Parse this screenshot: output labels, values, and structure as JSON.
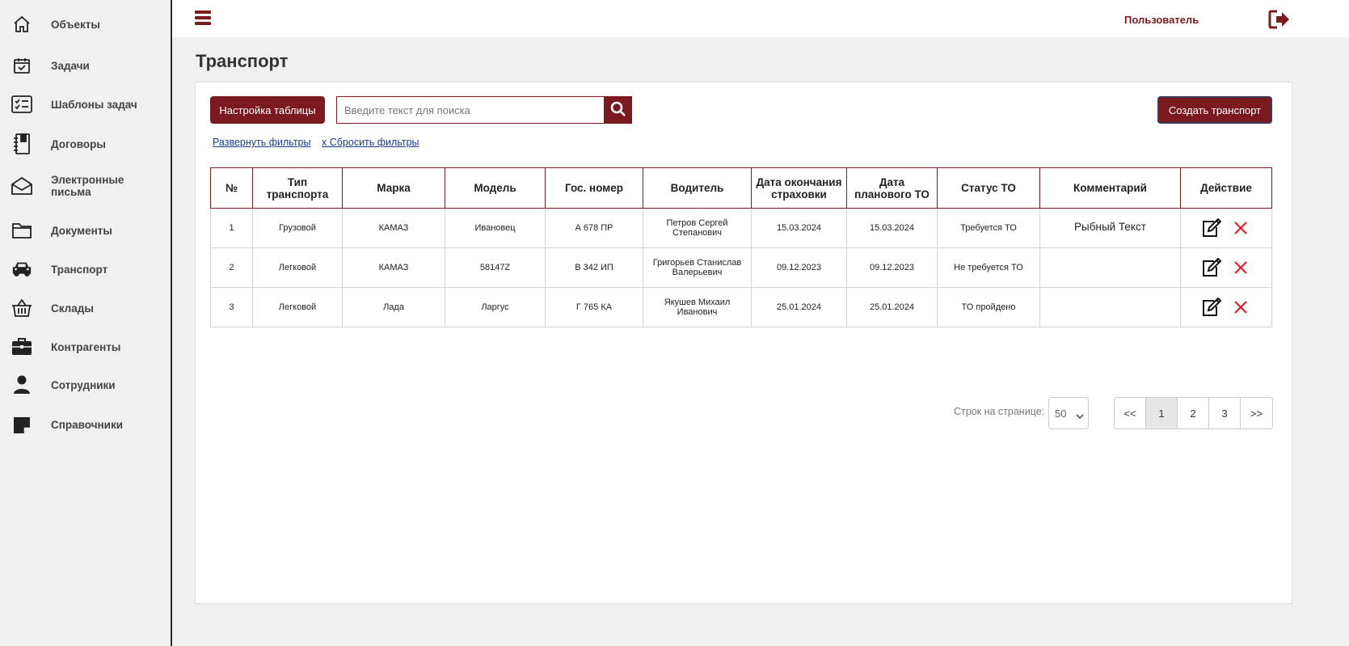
{
  "sidebar": {
    "items": [
      {
        "label": "Объекты",
        "icon": "home-icon"
      },
      {
        "label": "Задачи",
        "icon": "calendar-check-icon"
      },
      {
        "label": "Шаблоны задач",
        "icon": "checklist-icon"
      },
      {
        "label": "Договоры",
        "icon": "notebook-icon"
      },
      {
        "label": "Электронные письма",
        "icon": "envelope-icon"
      },
      {
        "label": "Документы",
        "icon": "folder-icon"
      },
      {
        "label": "Транспорт",
        "icon": "car-icon"
      },
      {
        "label": "Склады",
        "icon": "basket-icon"
      },
      {
        "label": "Контрагенты",
        "icon": "briefcase-icon"
      },
      {
        "label": "Сотрудники",
        "icon": "person-icon"
      },
      {
        "label": "Справочники",
        "icon": "sticky-note-icon"
      }
    ]
  },
  "header": {
    "user_label": "Пользователь",
    "menu_icon": "hamburger-icon",
    "logout_icon": "logout-icon"
  },
  "page": {
    "title": "Транспорт"
  },
  "toolbar": {
    "settings_label": "Настройка таблицы",
    "search_placeholder": "Введите текст для поиска",
    "create_label": "Создать транспорт",
    "expand_filters": "Развернуть фильтры",
    "reset_filters": "x Сбросить фильтры"
  },
  "table": {
    "columns": [
      "№",
      "Тип транспорта",
      "Марка",
      "Модель",
      "Гос. номер",
      "Водитель",
      "Дата окончания страховки",
      "Дата планового ТО",
      "Статус ТО",
      "Комментарий",
      "Действие"
    ],
    "rows": [
      [
        "1",
        "Грузовой",
        "КАМАЗ",
        "Ивановец",
        "А 678 ПР",
        "Петров Сергей Степанович",
        "15.03.2024",
        "15.03.2024",
        "Требуется ТО",
        "Рыбный Текст"
      ],
      [
        "2",
        "Легковой",
        "КАМАЗ",
        "58147Z",
        "В 342 ИП",
        "Григорьев Станислав Валерьевич",
        "09.12.2023",
        "09.12.2023",
        "Не требуется ТО",
        ""
      ],
      [
        "3",
        "Легковой",
        "Лада",
        "Ларгус",
        "Г 765 КА",
        "Якушев Михаил Иванович",
        "25.01.2024",
        "25.01.2024",
        "ТО пройдено",
        ""
      ]
    ]
  },
  "pagination": {
    "rows_label": "Строк на странице:",
    "rows_value": "50",
    "first": "<<",
    "pages": [
      "1",
      "2",
      "3"
    ],
    "last": ">>",
    "current": "1"
  },
  "colors": {
    "accent": "#7a1a1f",
    "delete": "#e0202a"
  }
}
